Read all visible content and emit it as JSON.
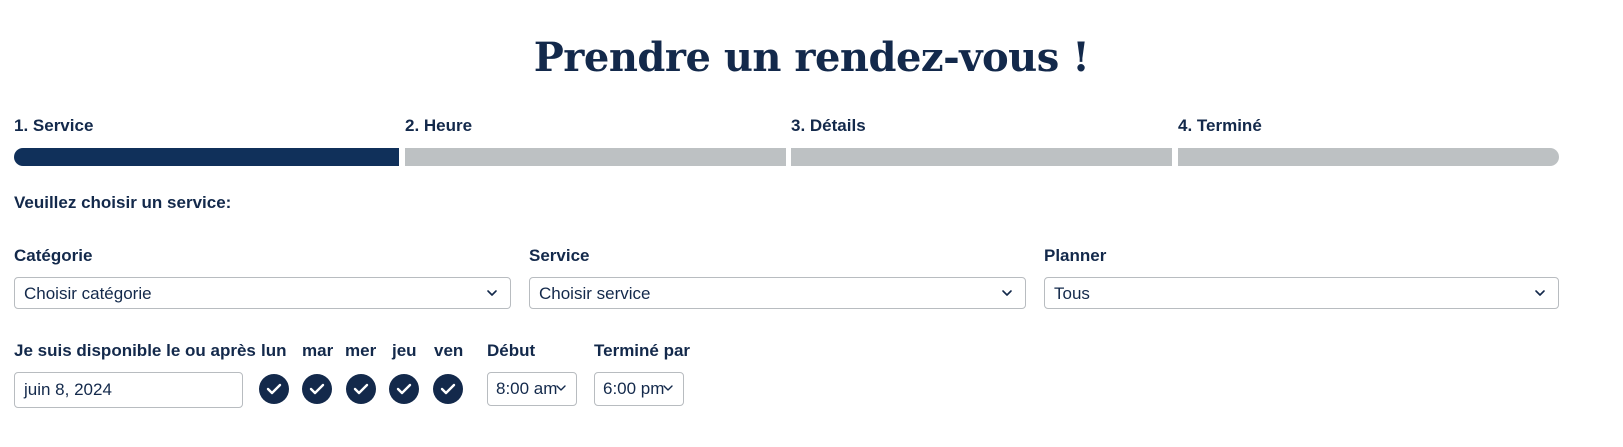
{
  "page": {
    "title": "Prendre un rendez-vous !"
  },
  "steps": [
    {
      "label": "1. Service",
      "active": true
    },
    {
      "label": "2. Heure",
      "active": false
    },
    {
      "label": "3. Détails",
      "active": false
    },
    {
      "label": "4. Terminé",
      "active": false
    }
  ],
  "form": {
    "prompt": "Veuillez choisir un service:",
    "category": {
      "label": "Catégorie",
      "value": "Choisir catégorie"
    },
    "service": {
      "label": "Service",
      "value": "Choisir service"
    },
    "planner": {
      "label": "Planner",
      "value": "Tous"
    },
    "availability": {
      "label": "Je suis disponible le ou après",
      "date": "juin 8, 2024"
    },
    "days": [
      {
        "label": "lun",
        "checked": true
      },
      {
        "label": "mar",
        "checked": true
      },
      {
        "label": "mer",
        "checked": true
      },
      {
        "label": "jeu",
        "checked": true
      },
      {
        "label": "ven",
        "checked": true
      }
    ],
    "start": {
      "label": "Début",
      "value": "8:00 am"
    },
    "end": {
      "label": "Terminé par",
      "value": "6:00 pm"
    }
  },
  "colors": {
    "primary": "#13294b",
    "step_active": "#10305a",
    "step_inactive": "#bdc1c3",
    "border": "#b8bcc0"
  },
  "icons": {
    "select_arrow": "chevron-down-icon",
    "day_checkbox": "check-circle-icon"
  }
}
